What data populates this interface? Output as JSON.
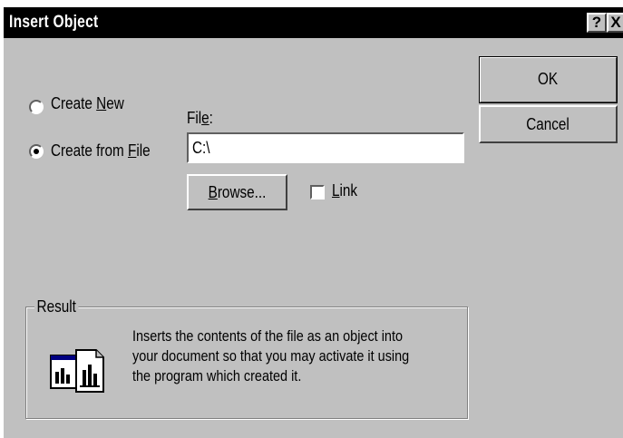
{
  "dialog": {
    "title": "Insert Object",
    "help_button": "?",
    "close_button": "X"
  },
  "options": {
    "create_new": {
      "prefix": "Create ",
      "accel": "N",
      "suffix": "ew",
      "selected": false
    },
    "create_from_file": {
      "prefix": "Create from ",
      "accel": "F",
      "suffix": "ile",
      "selected": true
    }
  },
  "file": {
    "label_prefix": "Fil",
    "label_accel": "e",
    "label_suffix": ":",
    "value": "C:\\"
  },
  "browse": {
    "accel": "B",
    "suffix": "rowse..."
  },
  "link": {
    "accel": "L",
    "suffix": "ink",
    "checked": false
  },
  "buttons": {
    "ok": "OK",
    "cancel": "Cancel"
  },
  "result": {
    "label": "Result",
    "line1": "Inserts the contents of the file as an object into",
    "line2": "your document so that you may activate it using",
    "line3": "the program which created it.",
    "icon": "insert-file-object-icon"
  }
}
